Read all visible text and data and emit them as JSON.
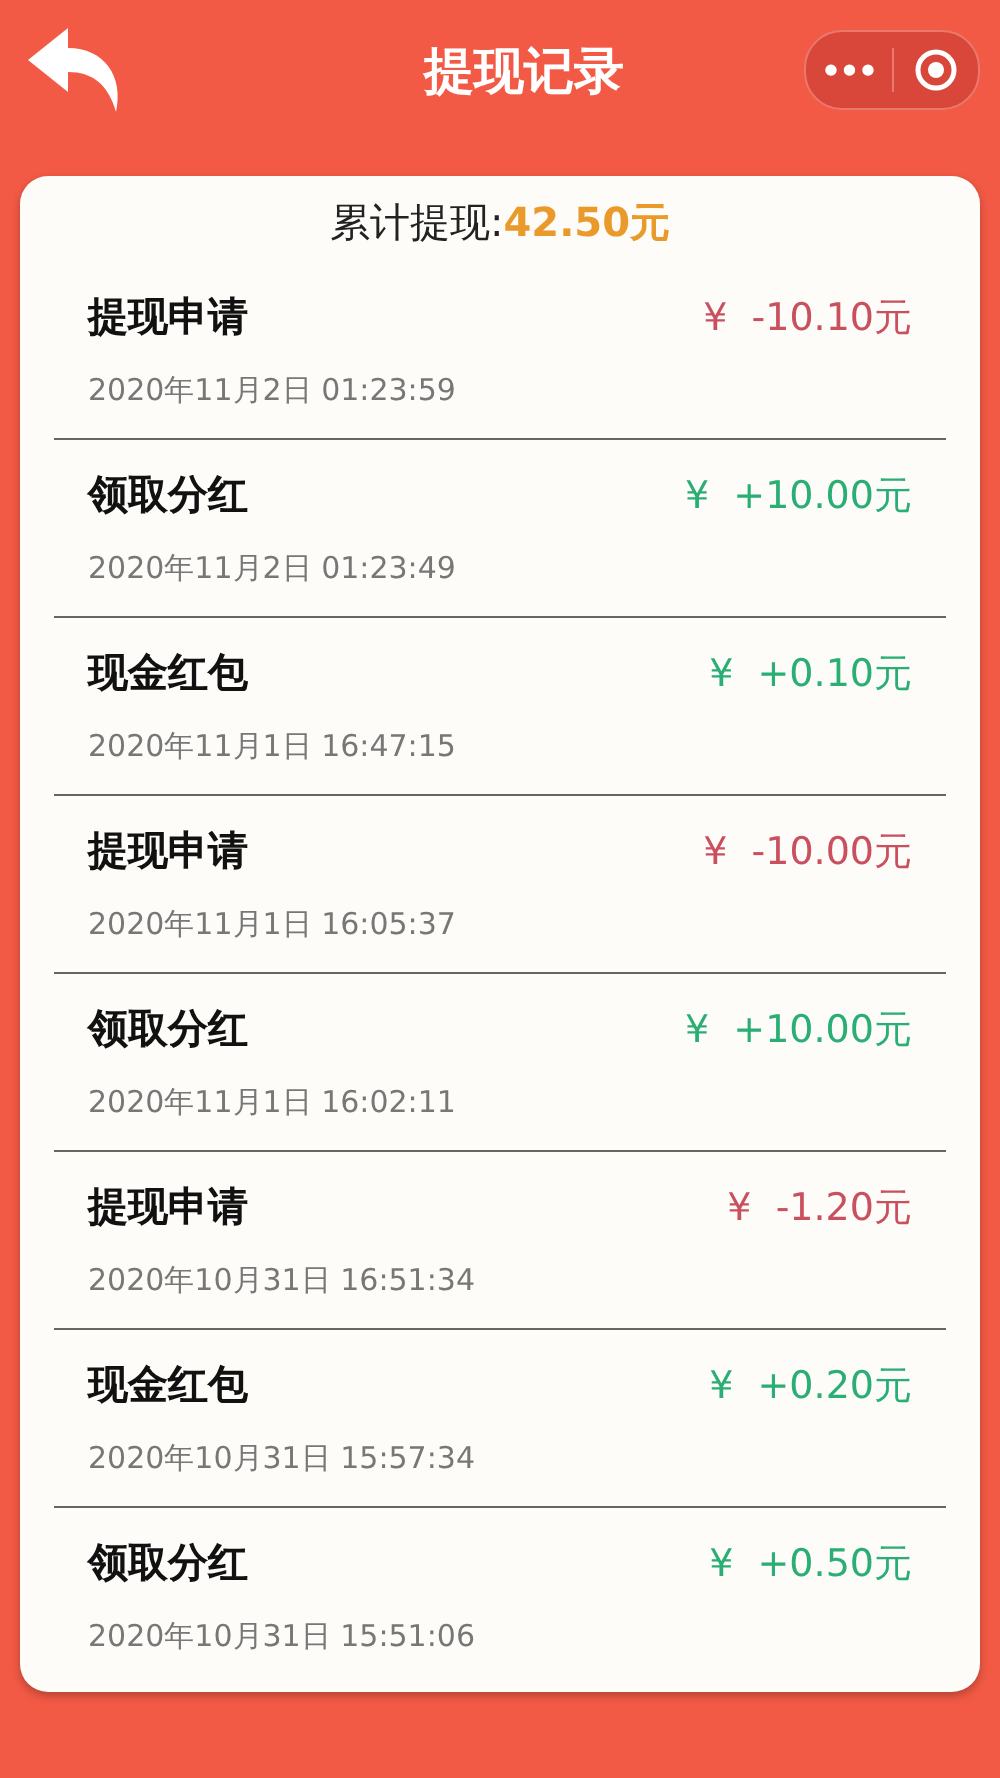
{
  "header": {
    "title": "提现记录",
    "menu_icon": "•••"
  },
  "summary": {
    "label": "累计提现:",
    "amount": "42.50元"
  },
  "records": [
    {
      "title": "提现申请",
      "time": "2020年11月2日 01:23:59",
      "currency": "¥",
      "amount": "-10.10元",
      "kind": "debit"
    },
    {
      "title": "领取分红",
      "time": "2020年11月2日 01:23:49",
      "currency": "¥",
      "amount": "+10.00元",
      "kind": "credit"
    },
    {
      "title": "现金红包",
      "time": "2020年11月1日 16:47:15",
      "currency": "¥",
      "amount": "+0.10元",
      "kind": "credit"
    },
    {
      "title": "提现申请",
      "time": "2020年11月1日 16:05:37",
      "currency": "¥",
      "amount": "-10.00元",
      "kind": "debit"
    },
    {
      "title": "领取分红",
      "time": "2020年11月1日 16:02:11",
      "currency": "¥",
      "amount": "+10.00元",
      "kind": "credit"
    },
    {
      "title": "提现申请",
      "time": "2020年10月31日 16:51:34",
      "currency": "¥",
      "amount": "-1.20元",
      "kind": "debit"
    },
    {
      "title": "现金红包",
      "time": "2020年10月31日 15:57:34",
      "currency": "¥",
      "amount": "+0.20元",
      "kind": "credit"
    },
    {
      "title": "领取分红",
      "time": "2020年10月31日 15:51:06",
      "currency": "¥",
      "amount": "+0.50元",
      "kind": "credit"
    }
  ]
}
